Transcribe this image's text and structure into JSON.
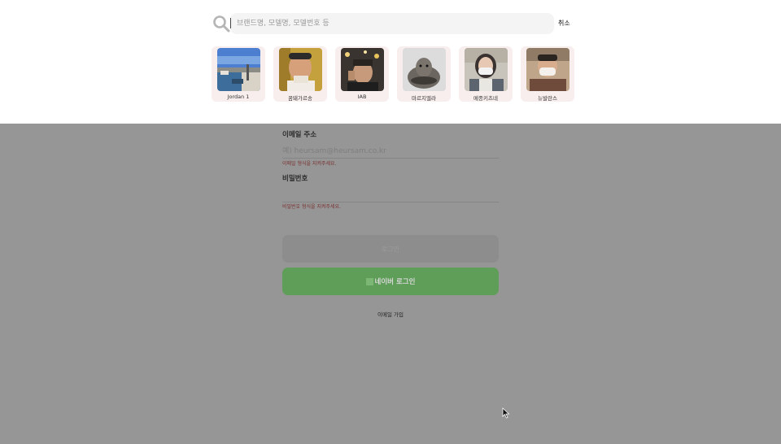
{
  "search": {
    "placeholder": "브랜드명, 모델명, 모델번호 등",
    "cancel_label": "취소",
    "icon": "search-icon"
  },
  "brands": [
    {
      "label": "Jordan 1"
    },
    {
      "label": "꿈돼가르송"
    },
    {
      "label": "IAB"
    },
    {
      "label": "마르지엘라"
    },
    {
      "label": "메종키츠네"
    },
    {
      "label": "뉴발란스"
    }
  ],
  "login": {
    "email_label": "이메일 주소",
    "email_placeholder": "예) heursam@heursam.co.kr",
    "email_error": "이메일 형식을 지켜주세요.",
    "password_label": "비밀번호",
    "password_error": "비밀번호 형식을 지켜주세요.",
    "login_button": "로그인",
    "naver_button": "네이버 로그인",
    "signup_link": "이메일 가입"
  },
  "colors": {
    "overlay": "#969696",
    "naver_green": "#5f9e59",
    "card_bg": "#f8eeee"
  }
}
